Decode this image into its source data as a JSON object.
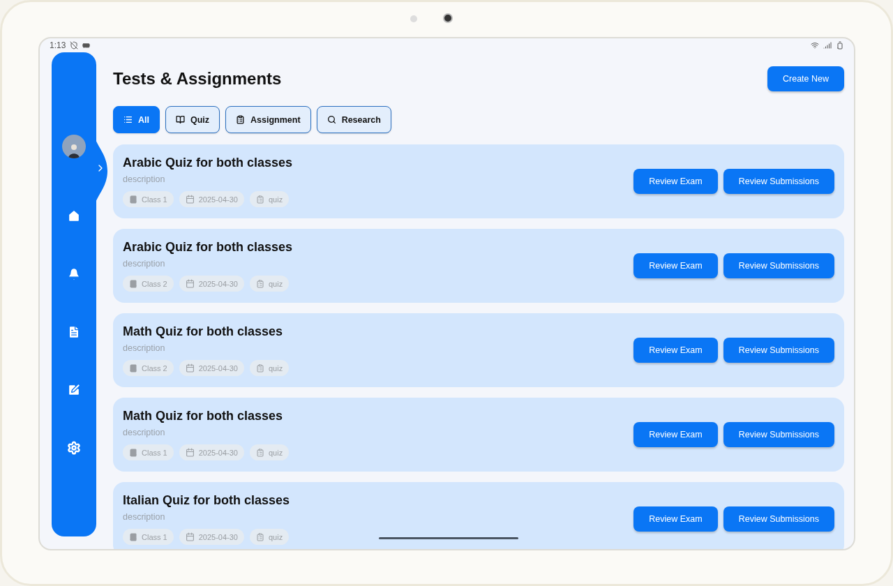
{
  "status_bar": {
    "time": "1:13"
  },
  "page": {
    "title": "Tests & Assignments",
    "create_button": "Create New"
  },
  "filters": [
    {
      "label": "All",
      "selected": true
    },
    {
      "label": "Quiz",
      "selected": false
    },
    {
      "label": "Assignment",
      "selected": false
    },
    {
      "label": "Research",
      "selected": false
    }
  ],
  "cards": [
    {
      "title": "Arabic Quiz for both classes",
      "description": "description",
      "class": "Class 1",
      "date": "2025-04-30",
      "type": "quiz",
      "buttons": [
        "Review Exam",
        "Review Submissions"
      ]
    },
    {
      "title": "Arabic Quiz for both classes",
      "description": "description",
      "class": "Class 2",
      "date": "2025-04-30",
      "type": "quiz",
      "buttons": [
        "Review Exam",
        "Review Submissions"
      ]
    },
    {
      "title": "Math Quiz for both classes",
      "description": "description",
      "class": "Class 2",
      "date": "2025-04-30",
      "type": "quiz",
      "buttons": [
        "Review Exam",
        "Review Submissions"
      ]
    },
    {
      "title": "Math Quiz for both classes",
      "description": "description",
      "class": "Class 1",
      "date": "2025-04-30",
      "type": "quiz",
      "buttons": [
        "Review Exam",
        "Review Submissions"
      ]
    },
    {
      "title": "Italian Quiz for both classes",
      "description": "description",
      "class": "Class 1",
      "date": "2025-04-30",
      "type": "quiz",
      "buttons": [
        "Review Exam",
        "Review Submissions"
      ]
    }
  ]
}
